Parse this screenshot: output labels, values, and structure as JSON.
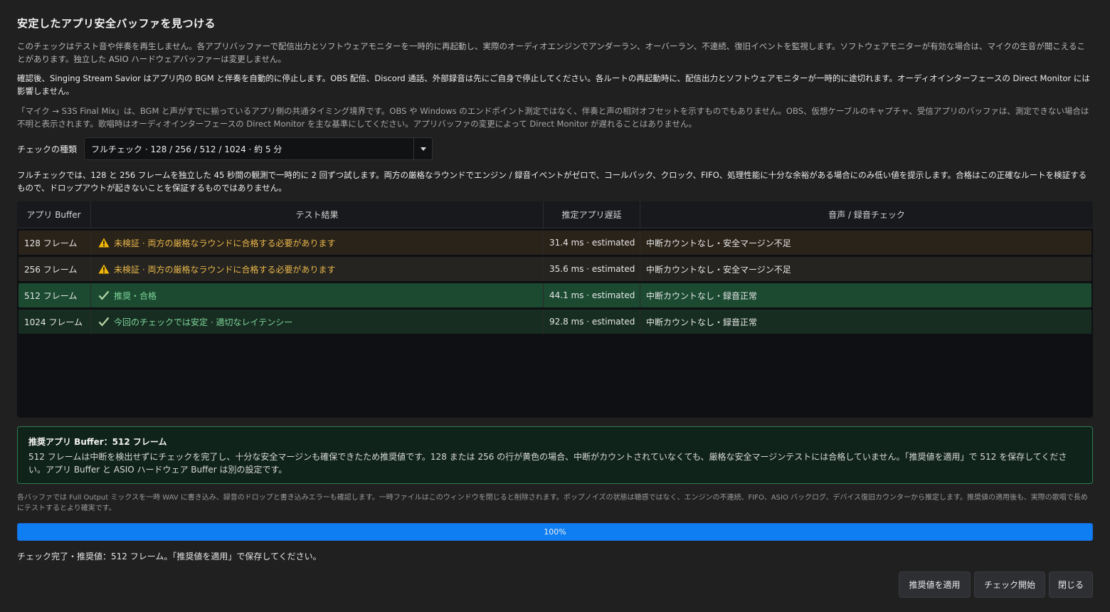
{
  "title": "安定したアプリ安全バッファを見つける",
  "paragraphs": {
    "p1": "このチェックはテスト音や伴奏を再生しません。各アプリバッファーで配信出力とソフトウェアモニターを一時的に再起動し、実際のオーディオエンジンでアンダーラン、オーバーラン、不連続、復旧イベントを監視します。ソフトウェアモニターが有効な場合は、マイクの生音が聞こえることがあります。独立した ASIO ハードウェアバッファーは変更しません。",
    "p2": "確認後、Singing Stream Savior はアプリ内の BGM と伴奏を自動的に停止します。OBS 配信、Discord 通話、外部録音は先にご自身で停止してください。各ルートの再起動時に、配信出力とソフトウェアモニターが一時的に途切れます。オーディオインターフェースの Direct Monitor には影響しません。",
    "p3": "「マイク → S3S Final Mix」は、BGM と声がすでに揃っているアプリ側の共通タイミング境界です。OBS や Windows のエンドポイント測定ではなく、伴奏と声の相対オフセットを示すものでもありません。OBS、仮想ケーブルのキャプチャ、受信アプリのバッファは、測定できない場合は不明と表示されます。歌唱時はオーディオインターフェースの Direct Monitor を主な基準にしてください。アプリバッファの変更によって Direct Monitor が遅れることはありません。",
    "p4": "フルチェックでは、128 と 256 フレームを独立した 45 秒間の観測で一時的に 2 回ずつ試します。両方の厳格なラウンドでエンジン / 録音イベントがゼロで、コールバック、クロック、FIFO、処理性能に十分な余裕がある場合にのみ低い値を提示します。合格はこの正確なルートを検証するもので、ドロップアウトが起きないことを保証するものではありません。"
  },
  "check_type": {
    "label": "チェックの種類",
    "value": "フルチェック · 128 / 256 / 512 / 1024 · 約 5 分"
  },
  "table": {
    "headers": [
      "アプリ Buffer",
      "テスト結果",
      "推定アプリ遅延",
      "音声 / 録音チェック"
    ],
    "rows": [
      {
        "buffer": "128 フレーム",
        "status": "未検証 · 両方の厳格なラウンドに合格する必要があります",
        "latency": "31.4 ms · estimated",
        "audio": "中断カウントなし・安全マージン不足"
      },
      {
        "buffer": "256 フレーム",
        "status": "未検証 · 両方の厳格なラウンドに合格する必要があります",
        "latency": "35.6 ms · estimated",
        "audio": "中断カウントなし・安全マージン不足"
      },
      {
        "buffer": "512 フレーム",
        "status": "推奨・合格",
        "latency": "44.1 ms · estimated",
        "audio": "中断カウントなし・録音正常"
      },
      {
        "buffer": "1024 フレーム",
        "status": "今回のチェックでは安定 · 適切なレイテンシー",
        "latency": "92.8 ms · estimated",
        "audio": "中断カウントなし・録音正常"
      }
    ]
  },
  "recommendation": {
    "title": "推奨アプリ Buffer：512 フレーム",
    "body": "512 フレームは中断を検出せずにチェックを完了し、十分な安全マージンも確保できたため推奨値です。128 または 256 の行が黄色の場合、中断がカウントされていなくても、厳格な安全マージンテストには合格していません。「推奨値を適用」で 512 を保存してください。アプリ Buffer と ASIO ハードウェア Buffer は別の設定です。"
  },
  "note": "各バッファでは Full Output ミックスを一時 WAV に書き込み、録音のドロップと書き込みエラーも確認します。一時ファイルはこのウィンドウを閉じると削除されます。ポップノイズの状態は聴感ではなく、エンジンの不連続、FIFO、ASIO バックログ、デバイス復旧カウンターから推定します。推奨値の適用後も、実際の歌唱で長めにテストするとより確実です。",
  "progress": {
    "value": 1.0,
    "label": "100%"
  },
  "status_text": "チェック完了・推奨値：512 フレーム。「推奨値を適用」で保存してください。",
  "buttons": {
    "apply": "推奨値を適用",
    "start": "チェック開始",
    "close": "閉じる"
  },
  "icons": {
    "warning": "warning-icon",
    "check": "check-icon",
    "dropdown": "chevron-down-icon"
  },
  "colors": {
    "warning": "#e8b64a",
    "success": "#7fd59a",
    "accent": "#0f7ef2",
    "recommend_border": "#2f7a4f"
  }
}
